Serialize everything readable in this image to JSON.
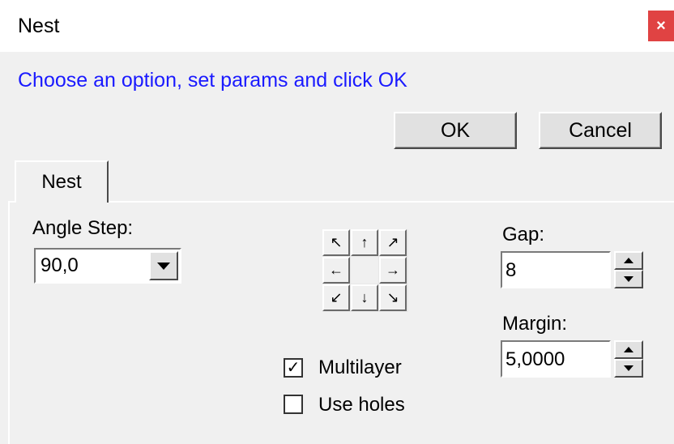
{
  "window": {
    "title": "Nest",
    "close_label": "×"
  },
  "instruction": "Choose an option, set params and click OK",
  "buttons": {
    "ok": "OK",
    "cancel": "Cancel"
  },
  "tab": {
    "label": "Nest"
  },
  "angle_step": {
    "label": "Angle Step:",
    "value": "90,0"
  },
  "direction_grid": {
    "cells": [
      "↖",
      "↑",
      "↗",
      "←",
      "",
      "→",
      "↙",
      "↓",
      "↘"
    ]
  },
  "gap": {
    "label": "Gap:",
    "value": "8"
  },
  "margin": {
    "label": "Margin:",
    "value": "5,0000"
  },
  "options": {
    "multilayer": {
      "label": "Multilayer",
      "checked": true,
      "check_glyph": "✓"
    },
    "use_holes": {
      "label": "Use holes",
      "checked": false,
      "check_glyph": ""
    }
  },
  "colors": {
    "instruction": "#1a1aff",
    "close_bg": "#e04343",
    "background": "#f0f0f0"
  }
}
